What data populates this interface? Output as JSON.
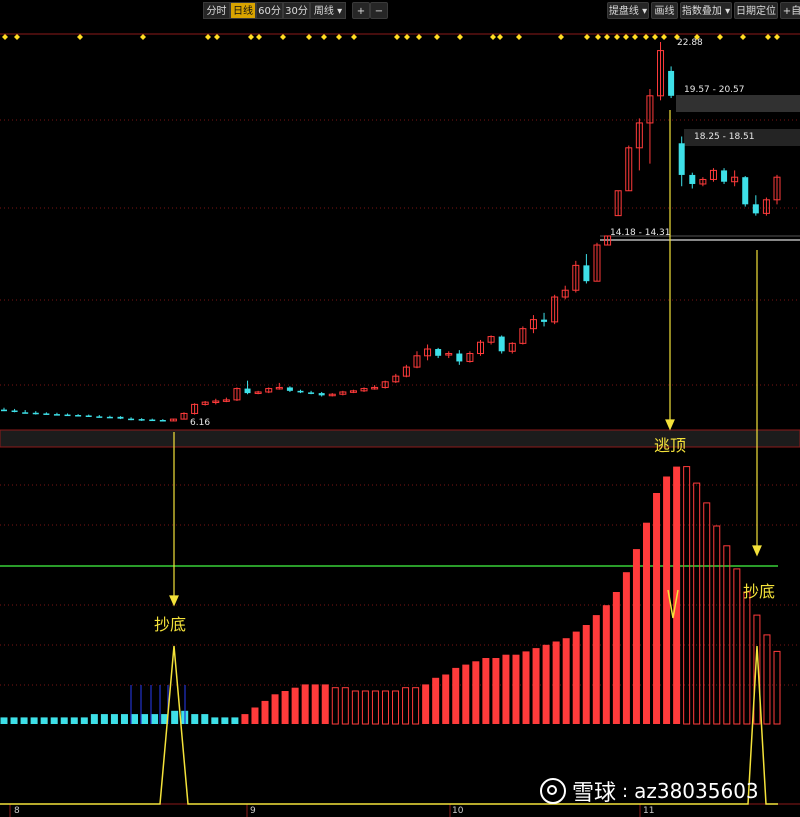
{
  "toolbar": {
    "period_buttons": [
      "分时",
      "日线",
      "60分",
      "30分",
      "周线 ▾"
    ],
    "active_period": "日线",
    "zoom_in": "+",
    "zoom_out": "−",
    "tools": [
      "提盘线 ▾",
      "画线",
      "指数叠加 ▾",
      "日期定位",
      "+自"
    ]
  },
  "price_panel": {
    "high_label": "22.88",
    "low_label": "6.16",
    "zones": [
      {
        "label": "19.57 - 20.57"
      },
      {
        "label": "18.25 - 18.51"
      },
      {
        "label": "14.18 - 14.31"
      }
    ]
  },
  "annotations": {
    "top": "逃顶",
    "bottom_left": "抄底",
    "bottom_right": "抄底"
  },
  "x_axis_labels": [
    "8",
    "9",
    "10",
    "11"
  ],
  "watermark": {
    "site": "雪球",
    "separator": ":",
    "user": "az38035603"
  },
  "colors": {
    "up": "#ff3b3b",
    "down": "#3ee0e8",
    "signal": "#f4e23a",
    "threshold": "#38d038",
    "background": "#000000"
  },
  "candles": [
    {
      "o": 6.62,
      "h": 6.7,
      "l": 6.55,
      "c": 6.55
    },
    {
      "o": 6.58,
      "h": 6.65,
      "l": 6.5,
      "c": 6.52
    },
    {
      "o": 6.5,
      "h": 6.6,
      "l": 6.45,
      "c": 6.48
    },
    {
      "o": 6.48,
      "h": 6.55,
      "l": 6.4,
      "c": 6.45
    },
    {
      "o": 6.45,
      "h": 6.5,
      "l": 6.4,
      "c": 6.42
    },
    {
      "o": 6.42,
      "h": 6.48,
      "l": 6.38,
      "c": 6.4
    },
    {
      "o": 6.4,
      "h": 6.45,
      "l": 6.35,
      "c": 6.38
    },
    {
      "o": 6.38,
      "h": 6.42,
      "l": 6.33,
      "c": 6.36
    },
    {
      "o": 6.36,
      "h": 6.4,
      "l": 6.3,
      "c": 6.32
    },
    {
      "o": 6.32,
      "h": 6.38,
      "l": 6.28,
      "c": 6.3
    },
    {
      "o": 6.3,
      "h": 6.35,
      "l": 6.25,
      "c": 6.28
    },
    {
      "o": 6.3,
      "h": 6.33,
      "l": 6.2,
      "c": 6.22
    },
    {
      "o": 6.22,
      "h": 6.28,
      "l": 6.15,
      "c": 6.18
    },
    {
      "o": 6.2,
      "h": 6.24,
      "l": 6.12,
      "c": 6.16
    },
    {
      "o": 6.18,
      "h": 6.22,
      "l": 6.12,
      "c": 6.14
    },
    {
      "o": 6.16,
      "h": 6.2,
      "l": 6.1,
      "c": 6.12
    },
    {
      "o": 6.12,
      "h": 6.22,
      "l": 6.1,
      "c": 6.2
    },
    {
      "o": 6.2,
      "h": 6.5,
      "l": 6.18,
      "c": 6.45
    },
    {
      "o": 6.45,
      "h": 6.9,
      "l": 6.4,
      "c": 6.85
    },
    {
      "o": 6.85,
      "h": 7.0,
      "l": 6.8,
      "c": 6.95
    },
    {
      "o": 6.95,
      "h": 7.1,
      "l": 6.85,
      "c": 7.0
    },
    {
      "o": 7.0,
      "h": 7.15,
      "l": 6.95,
      "c": 7.05
    },
    {
      "o": 7.05,
      "h": 7.6,
      "l": 7.0,
      "c": 7.55
    },
    {
      "o": 7.55,
      "h": 7.9,
      "l": 7.3,
      "c": 7.35
    },
    {
      "o": 7.35,
      "h": 7.45,
      "l": 7.3,
      "c": 7.4
    },
    {
      "o": 7.4,
      "h": 7.6,
      "l": 7.35,
      "c": 7.55
    },
    {
      "o": 7.55,
      "h": 7.8,
      "l": 7.5,
      "c": 7.6
    },
    {
      "o": 7.6,
      "h": 7.65,
      "l": 7.4,
      "c": 7.45
    },
    {
      "o": 7.45,
      "h": 7.5,
      "l": 7.35,
      "c": 7.38
    },
    {
      "o": 7.38,
      "h": 7.45,
      "l": 7.3,
      "c": 7.35
    },
    {
      "o": 7.35,
      "h": 7.4,
      "l": 7.2,
      "c": 7.25
    },
    {
      "o": 7.25,
      "h": 7.35,
      "l": 7.2,
      "c": 7.3
    },
    {
      "o": 7.3,
      "h": 7.45,
      "l": 7.25,
      "c": 7.4
    },
    {
      "o": 7.4,
      "h": 7.5,
      "l": 7.35,
      "c": 7.45
    },
    {
      "o": 7.45,
      "h": 7.6,
      "l": 7.4,
      "c": 7.55
    },
    {
      "o": 7.55,
      "h": 7.7,
      "l": 7.5,
      "c": 7.6
    },
    {
      "o": 7.6,
      "h": 7.9,
      "l": 7.55,
      "c": 7.85
    },
    {
      "o": 7.85,
      "h": 8.2,
      "l": 7.8,
      "c": 8.1
    },
    {
      "o": 8.1,
      "h": 8.6,
      "l": 8.05,
      "c": 8.5
    },
    {
      "o": 8.5,
      "h": 9.2,
      "l": 8.45,
      "c": 9.0
    },
    {
      "o": 9.0,
      "h": 9.5,
      "l": 8.8,
      "c": 9.3
    },
    {
      "o": 9.3,
      "h": 9.35,
      "l": 8.9,
      "c": 9.0
    },
    {
      "o": 9.05,
      "h": 9.2,
      "l": 8.9,
      "c": 9.1
    },
    {
      "o": 9.1,
      "h": 9.25,
      "l": 8.6,
      "c": 8.75
    },
    {
      "o": 8.75,
      "h": 9.2,
      "l": 8.7,
      "c": 9.1
    },
    {
      "o": 9.1,
      "h": 9.7,
      "l": 9.0,
      "c": 9.6
    },
    {
      "o": 9.6,
      "h": 9.9,
      "l": 9.5,
      "c": 9.85
    },
    {
      "o": 9.85,
      "h": 9.9,
      "l": 9.1,
      "c": 9.2
    },
    {
      "o": 9.2,
      "h": 9.6,
      "l": 9.1,
      "c": 9.55
    },
    {
      "o": 9.55,
      "h": 10.3,
      "l": 9.5,
      "c": 10.2
    },
    {
      "o": 10.2,
      "h": 10.8,
      "l": 10.0,
      "c": 10.6
    },
    {
      "o": 10.6,
      "h": 10.9,
      "l": 10.3,
      "c": 10.5
    },
    {
      "o": 10.5,
      "h": 11.7,
      "l": 10.4,
      "c": 11.6
    },
    {
      "o": 11.6,
      "h": 12.1,
      "l": 11.5,
      "c": 11.9
    },
    {
      "o": 11.9,
      "h": 13.2,
      "l": 11.8,
      "c": 13.0
    },
    {
      "o": 13.0,
      "h": 13.5,
      "l": 12.2,
      "c": 12.3
    },
    {
      "o": 12.3,
      "h": 14.0,
      "l": 12.3,
      "c": 13.9
    },
    {
      "o": 13.9,
      "h": 14.3,
      "l": 13.9,
      "c": 14.3
    },
    {
      "o": 15.2,
      "h": 16.3,
      "l": 15.2,
      "c": 16.3
    },
    {
      "o": 16.3,
      "h": 18.3,
      "l": 16.3,
      "c": 18.2
    },
    {
      "o": 18.2,
      "h": 19.5,
      "l": 17.2,
      "c": 19.3
    },
    {
      "o": 19.3,
      "h": 20.8,
      "l": 17.5,
      "c": 20.5
    },
    {
      "o": 20.5,
      "h": 22.88,
      "l": 20.3,
      "c": 22.5
    },
    {
      "o": 21.6,
      "h": 21.8,
      "l": 20.4,
      "c": 20.5
    },
    {
      "o": 18.4,
      "h": 18.7,
      "l": 16.5,
      "c": 17.0
    },
    {
      "o": 17.0,
      "h": 17.1,
      "l": 16.4,
      "c": 16.6
    },
    {
      "o": 16.6,
      "h": 16.9,
      "l": 16.5,
      "c": 16.8
    },
    {
      "o": 16.8,
      "h": 17.3,
      "l": 16.7,
      "c": 17.2
    },
    {
      "o": 17.2,
      "h": 17.3,
      "l": 16.6,
      "c": 16.7
    },
    {
      "o": 16.7,
      "h": 17.2,
      "l": 16.5,
      "c": 16.9
    },
    {
      "o": 16.9,
      "h": 16.95,
      "l": 15.6,
      "c": 15.7
    },
    {
      "o": 15.7,
      "h": 16.1,
      "l": 15.2,
      "c": 15.3
    },
    {
      "o": 15.3,
      "h": 16.0,
      "l": 15.2,
      "c": 15.9
    },
    {
      "o": 15.9,
      "h": 17.0,
      "l": 15.7,
      "c": 16.9
    }
  ],
  "indicator_bars": [
    {
      "v": 2,
      "c": "cyan"
    },
    {
      "v": 2,
      "c": "cyan"
    },
    {
      "v": 2,
      "c": "cyan"
    },
    {
      "v": 2,
      "c": "cyan"
    },
    {
      "v": 2,
      "c": "cyan"
    },
    {
      "v": 2,
      "c": "cyan"
    },
    {
      "v": 2,
      "c": "cyan"
    },
    {
      "v": 2,
      "c": "cyan"
    },
    {
      "v": 2,
      "c": "cyan"
    },
    {
      "v": 3,
      "c": "cyan"
    },
    {
      "v": 3,
      "c": "cyan"
    },
    {
      "v": 3,
      "c": "cyan"
    },
    {
      "v": 3,
      "c": "cyan"
    },
    {
      "v": 3,
      "c": "cyan"
    },
    {
      "v": 3,
      "c": "cyan"
    },
    {
      "v": 3,
      "c": "cyan"
    },
    {
      "v": 3,
      "c": "cyan"
    },
    {
      "v": 4,
      "c": "cyan"
    },
    {
      "v": 4,
      "c": "cyan"
    },
    {
      "v": 3,
      "c": "cyan"
    },
    {
      "v": 3,
      "c": "cyan"
    },
    {
      "v": 2,
      "c": "cyan"
    },
    {
      "v": 2,
      "c": "cyan"
    },
    {
      "v": 2,
      "c": "cyan"
    },
    {
      "v": 3,
      "c": "red"
    },
    {
      "v": 5,
      "c": "red"
    },
    {
      "v": 7,
      "c": "red"
    },
    {
      "v": 9,
      "c": "red"
    },
    {
      "v": 10,
      "c": "red"
    },
    {
      "v": 11,
      "c": "red"
    },
    {
      "v": 12,
      "c": "red"
    },
    {
      "v": 12,
      "c": "red"
    },
    {
      "v": 12,
      "c": "red"
    },
    {
      "v": 11,
      "c": "red-o"
    },
    {
      "v": 11,
      "c": "red-o"
    },
    {
      "v": 10,
      "c": "red-o"
    },
    {
      "v": 10,
      "c": "red-o"
    },
    {
      "v": 10,
      "c": "red-o"
    },
    {
      "v": 10,
      "c": "red-o"
    },
    {
      "v": 10,
      "c": "red-o"
    },
    {
      "v": 11,
      "c": "red-o"
    },
    {
      "v": 11,
      "c": "red-o"
    },
    {
      "v": 12,
      "c": "red"
    },
    {
      "v": 14,
      "c": "red"
    },
    {
      "v": 15,
      "c": "red"
    },
    {
      "v": 17,
      "c": "red"
    },
    {
      "v": 18,
      "c": "red"
    },
    {
      "v": 19,
      "c": "red"
    },
    {
      "v": 20,
      "c": "red"
    },
    {
      "v": 20,
      "c": "red"
    },
    {
      "v": 21,
      "c": "red"
    },
    {
      "v": 21,
      "c": "red"
    },
    {
      "v": 22,
      "c": "red"
    },
    {
      "v": 23,
      "c": "red"
    },
    {
      "v": 24,
      "c": "red"
    },
    {
      "v": 25,
      "c": "red"
    },
    {
      "v": 26,
      "c": "red"
    },
    {
      "v": 28,
      "c": "red"
    },
    {
      "v": 30,
      "c": "red"
    },
    {
      "v": 33,
      "c": "red"
    },
    {
      "v": 36,
      "c": "red"
    },
    {
      "v": 40,
      "c": "red"
    },
    {
      "v": 46,
      "c": "red"
    },
    {
      "v": 53,
      "c": "red"
    },
    {
      "v": 61,
      "c": "red"
    },
    {
      "v": 70,
      "c": "red"
    },
    {
      "v": 75,
      "c": "red"
    },
    {
      "v": 78,
      "c": "red"
    },
    {
      "v": 78,
      "c": "red-o"
    },
    {
      "v": 73,
      "c": "red-o"
    },
    {
      "v": 67,
      "c": "red-o"
    },
    {
      "v": 60,
      "c": "red-o"
    },
    {
      "v": 54,
      "c": "red-o"
    },
    {
      "v": 47,
      "c": "red-o"
    },
    {
      "v": 40,
      "c": "red-o"
    },
    {
      "v": 33,
      "c": "red-o"
    },
    {
      "v": 27,
      "c": "red-o"
    },
    {
      "v": 22,
      "c": "red-o"
    }
  ]
}
